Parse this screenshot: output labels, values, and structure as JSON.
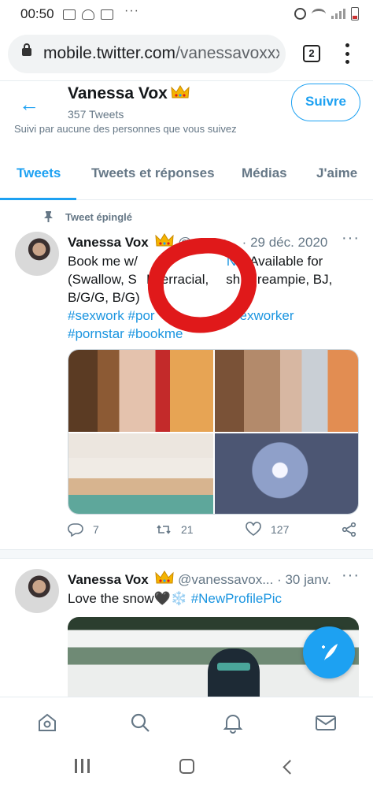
{
  "status_bar": {
    "time": "00:50",
    "dots": "···"
  },
  "browser": {
    "url_domain": "mobile.twitter.com",
    "url_path": "/vanessavoxxx",
    "tab_count": "2"
  },
  "profile": {
    "name": "Vanessa Vox",
    "tweet_count": "357 Tweets",
    "follow_label": "Suivre",
    "followed_by_note": "Suivi par aucune des personnes que vous suivez"
  },
  "tabs": [
    "Tweets",
    "Tweets et réponses",
    "Médias",
    "J'aime"
  ],
  "tweets": [
    {
      "pinned_label": "Tweet épinglé",
      "name": "Vanessa Vox",
      "handle_date": "@vanes... · 29 déc. 2020",
      "line1_a": "Book me w/",
      "line1_b": "NG",
      "line1_c": " Available for",
      "line2_a": "(Swallow, S",
      "line2_b": "Interracial,",
      "line2_c": "sh, Creampie, BJ,",
      "line3": "B/G/G, B/G)",
      "line4_a": "#sexwork",
      "line4_b": "#por",
      "line4_c": "#sexworker",
      "line5_a": "#pornstar",
      "line5_b": "#bookme",
      "replies": "7",
      "retweets": "21",
      "likes": "127"
    },
    {
      "name": "Vanessa Vox",
      "handle_date": "@vanessavox... · 30 janv.",
      "text": "Love the snow🖤❄️",
      "hashtag": "#NewProfilePic"
    }
  ],
  "colors": {
    "accent": "#1da1f2",
    "annotation": "#e0191a"
  },
  "icons": [
    "home-icon",
    "search-icon",
    "notifications-icon",
    "messages-icon",
    "compose-tweet-icon",
    "reply-icon",
    "retweet-icon",
    "like-icon",
    "share-icon",
    "pin-icon",
    "crown-emoji"
  ]
}
